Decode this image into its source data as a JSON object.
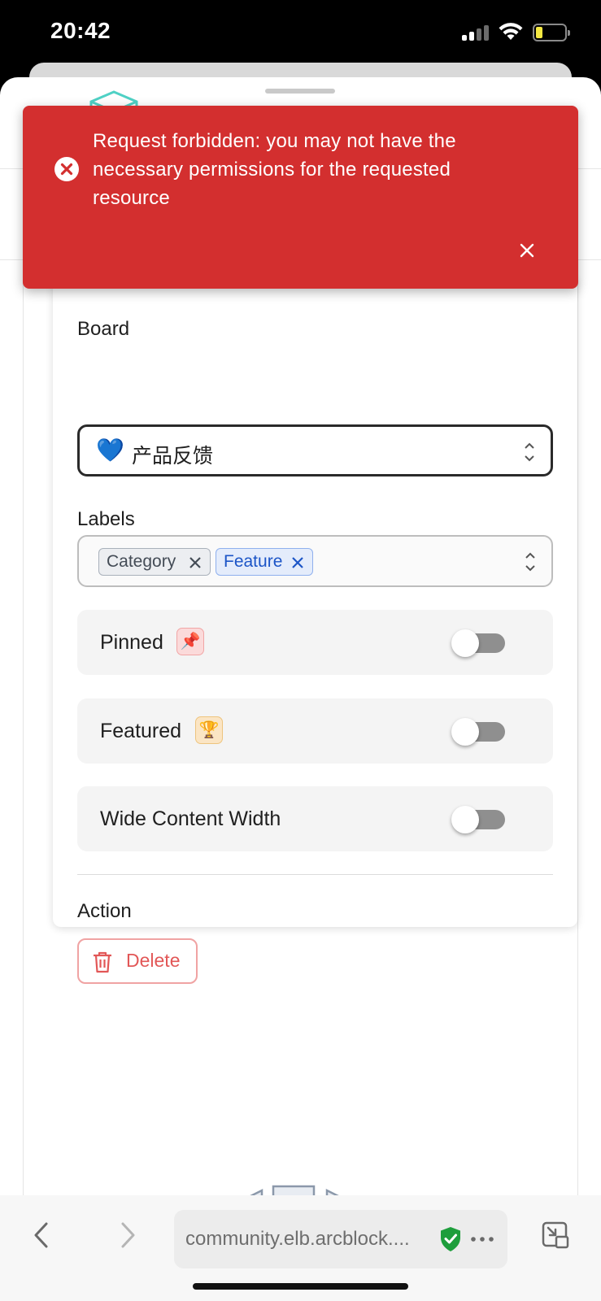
{
  "status_bar": {
    "time": "20:42",
    "signal_icon": "cellular-signal-icon",
    "wifi_icon": "wifi-icon",
    "battery_icon": "battery-low-icon"
  },
  "toast": {
    "severity": "error",
    "icon": "error-circle-icon",
    "message": "Request forbidden: you may not have the necessary permissions for the requested resource",
    "close_icon": "close-icon",
    "color": "#d32f2f"
  },
  "settings": {
    "board": {
      "label": "Board",
      "icon": "💙",
      "value": "产品反馈"
    },
    "labels": {
      "label": "Labels",
      "chips": [
        {
          "text": "Category"
        },
        {
          "text": "Feature"
        }
      ]
    },
    "toggles": {
      "pinned": {
        "label": "Pinned",
        "emoji": "📌",
        "on": false
      },
      "featured": {
        "label": "Featured",
        "emoji": "🏆",
        "on": false
      },
      "wide": {
        "label": "Wide Content Width",
        "on": false
      }
    },
    "action": {
      "label": "Action",
      "delete_label": "Delete",
      "delete_color": "#e25757"
    }
  },
  "browser": {
    "url": "community.elb.arcblock....",
    "secure_icon": "shield-check-icon",
    "secure_color": "#1e9e3c"
  }
}
